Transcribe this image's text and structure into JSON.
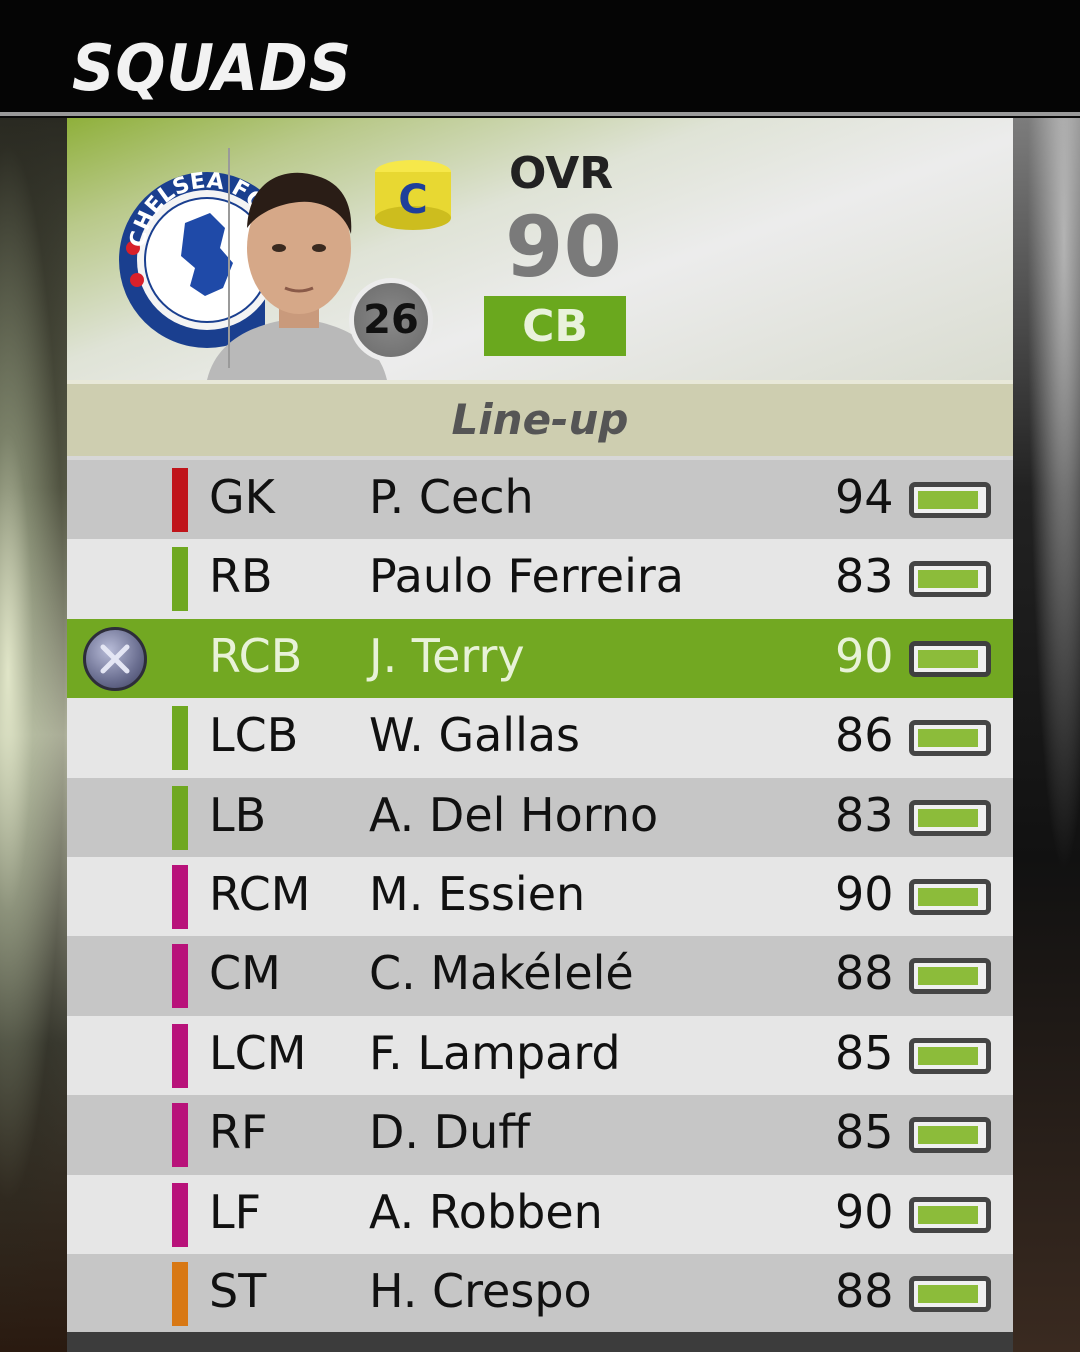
{
  "screen_title": "SQUADS",
  "player": {
    "shirt_number": "26",
    "ovr_label": "OVR",
    "ovr_value": "90",
    "position": "CB",
    "captain_letter": "C",
    "club_crest_text": "CHELSEA FOOTBALL CLUB"
  },
  "lineup_label": "Line-up",
  "lineup": [
    {
      "pos": "GK",
      "name": "P. Cech",
      "rating": "94",
      "role_color": "#c0141a",
      "fitness": 1.0
    },
    {
      "pos": "RB",
      "name": "Paulo Ferreira",
      "rating": "83",
      "role_color": "#6fa820",
      "fitness": 1.0
    },
    {
      "pos": "RCB",
      "name": "J. Terry",
      "rating": "90",
      "role_color": "#72a822",
      "fitness": 1.0,
      "selected": true
    },
    {
      "pos": "LCB",
      "name": "W. Gallas",
      "rating": "86",
      "role_color": "#6fa820",
      "fitness": 1.0
    },
    {
      "pos": "LB",
      "name": "A. Del Horno",
      "rating": "83",
      "role_color": "#6fa820",
      "fitness": 1.0
    },
    {
      "pos": "RCM",
      "name": "M. Essien",
      "rating": "90",
      "role_color": "#b8127a",
      "fitness": 1.0
    },
    {
      "pos": "CM",
      "name": "C. Makélelé",
      "rating": "88",
      "role_color": "#b8127a",
      "fitness": 1.0
    },
    {
      "pos": "LCM",
      "name": "F. Lampard",
      "rating": "85",
      "role_color": "#b8127a",
      "fitness": 1.0
    },
    {
      "pos": "RF",
      "name": "D. Duff",
      "rating": "85",
      "role_color": "#b8127a",
      "fitness": 1.0
    },
    {
      "pos": "LF",
      "name": "A. Robben",
      "rating": "90",
      "role_color": "#b8127a",
      "fitness": 1.0
    },
    {
      "pos": "ST",
      "name": "H. Crespo",
      "rating": "88",
      "role_color": "#d87814",
      "fitness": 1.0
    }
  ],
  "icons": {
    "select_button": "x-button-icon",
    "captain": "captain-armband-icon",
    "crest": "chelsea-crest-icon",
    "portrait": "player-portrait"
  },
  "colors": {
    "accent_green": "#72a822",
    "gk": "#c0141a",
    "defender": "#6fa820",
    "midfielder": "#b8127a",
    "forward": "#d87814"
  }
}
